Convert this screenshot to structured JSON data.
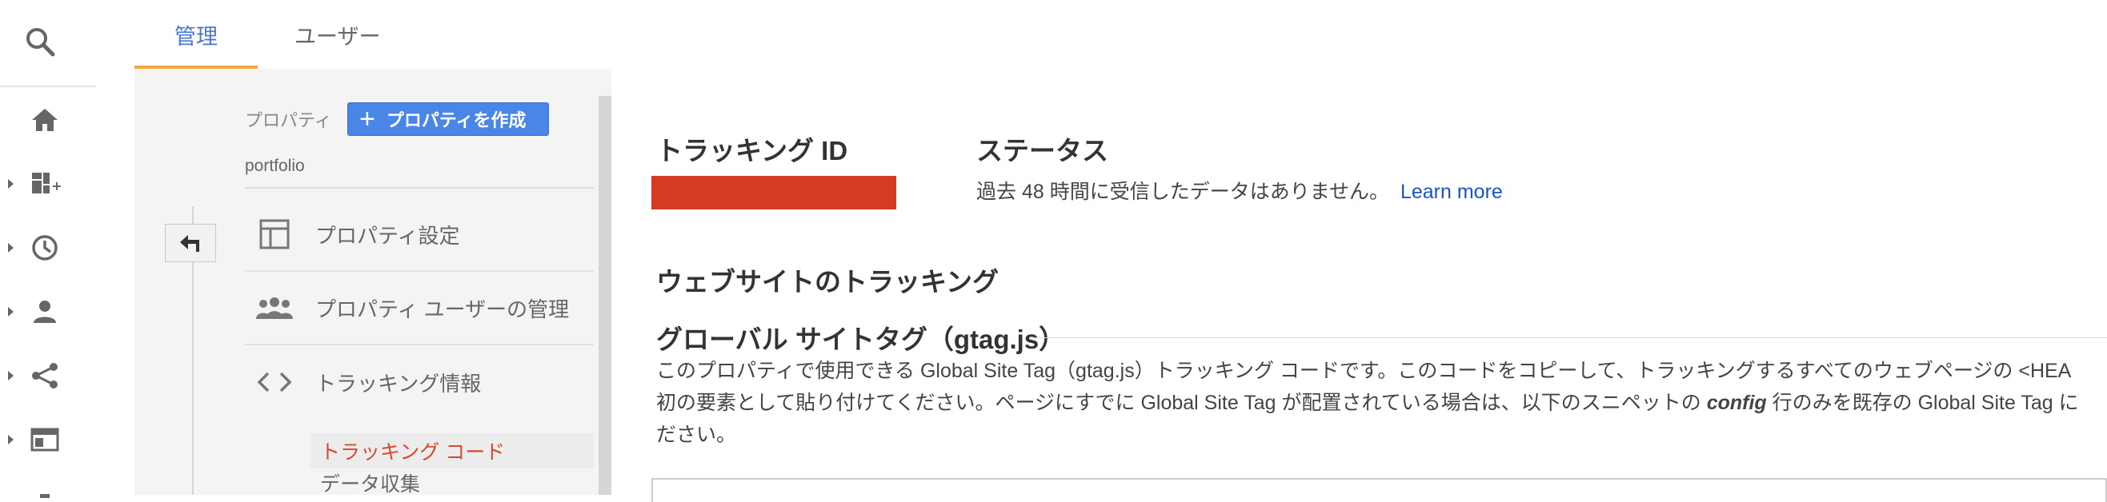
{
  "tabs": [
    {
      "label": "管理"
    },
    {
      "label": "ユーザー"
    }
  ],
  "admin": {
    "section_label": "プロパティ",
    "create_button": "プロパティを作成",
    "property_name": "portfolio",
    "nav": [
      {
        "label": "プロパティ設定",
        "icon": "layout-icon"
      },
      {
        "label": "プロパティ ユーザーの管理",
        "icon": "people-icon"
      },
      {
        "label": "トラッキング情報",
        "icon": "code-icon"
      }
    ],
    "sub_items": [
      {
        "label": "トラッキング コード",
        "active": true
      },
      {
        "label": "データ収集",
        "active": false
      }
    ]
  },
  "content": {
    "tracking_id_heading": "トラッキング ID",
    "status_heading": "ステータス",
    "status_text": "過去 48 時間に受信したデータはありません。",
    "learn_more": "Learn more",
    "website_tracking_heading": "ウェブサイトのトラッキング",
    "gtag_heading": "グローバル サイトタグ（gtag.js）",
    "desc_line1": "このプロパティで使用できる Global Site Tag（gtag.js）トラッキング コードです。このコードをコピーして、トラッキングするすべてのウェブページの <HEA",
    "desc_line2_a": "初の要素として貼り付けてください。ページにすでに Global Site Tag が配置されている場合は、以下のスニペットの ",
    "desc_line2_em": "config",
    "desc_line2_b": " 行のみを既存の Global Site Tag に",
    "desc_line3": "ださい。"
  },
  "colors": {
    "accent_blue": "#4a86e8",
    "tab_active": "#4a78c9",
    "tab_underline": "#f4a940",
    "active_sub": "#d54a2e",
    "redaction": "#d53a22",
    "link": "#1a55c4"
  },
  "rail_icons": [
    "search-icon",
    "home-icon",
    "dashboard-icon",
    "clock-icon",
    "person-icon",
    "acquisition-icon",
    "behavior-icon"
  ]
}
